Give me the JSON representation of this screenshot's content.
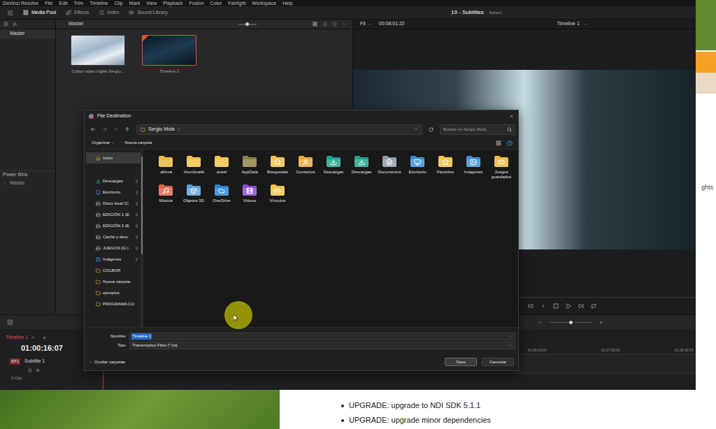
{
  "menubar": {
    "items": [
      "DaVinci Resolve",
      "File",
      "Edit",
      "Trim",
      "Timeline",
      "Clip",
      "Mark",
      "View",
      "Playback",
      "Fusion",
      "Color",
      "Fairlight",
      "Workspace",
      "Help"
    ]
  },
  "toolbar": {
    "panels": [
      {
        "label": "Media Pool",
        "selected": true
      },
      {
        "label": "Effects",
        "selected": false
      },
      {
        "label": "Index",
        "selected": false
      },
      {
        "label": "Sound Library",
        "selected": false
      }
    ],
    "project": "19 - Subtitles",
    "status": "Edited"
  },
  "bins": {
    "master": "Master",
    "power_bins": "Power Bins",
    "power_bins_items": [
      "Master"
    ]
  },
  "media_pool": {
    "bin": "Master",
    "clips": [
      {
        "name": "Colbor video inglés Sergio...",
        "kind": "video",
        "selected": false
      },
      {
        "name": "Timeline 1",
        "kind": "timeline",
        "selected": true
      }
    ]
  },
  "viewer": {
    "zoom": "Fit",
    "timecode": "00:08:01:22",
    "timeline": "Timeline 1"
  },
  "timeline": {
    "tab": "Timeline 1",
    "timecode": "01:00:16:07",
    "track": {
      "id": "ST1",
      "name": "Subtitle 1",
      "clips": "0 Clip"
    },
    "ruler": [
      "01:06:24:00",
      "01:07:28:00",
      "01:08:32:00"
    ]
  },
  "dialog": {
    "title": "File Destination",
    "path": [
      "Sergio Mota"
    ],
    "search_placeholder": "Buscar en Sergio Mota",
    "commands": [
      {
        "label": "Organizar",
        "menu": true
      },
      {
        "label": "Nueva carpeta",
        "menu": false
      }
    ],
    "nav": [
      {
        "label": "Inicio",
        "kind": "home",
        "pinned": false,
        "selected": true
      },
      {
        "label": "Descargas",
        "kind": "download",
        "pinned": true,
        "selected": false
      },
      {
        "label": "Escritorio",
        "kind": "desktop",
        "pinned": true,
        "selected": false
      },
      {
        "label": "Disco local (C",
        "kind": "drive",
        "pinned": true,
        "selected": false
      },
      {
        "label": "EDICIÓN 1 (E",
        "kind": "drive",
        "pinned": true,
        "selected": false
      },
      {
        "label": "EDICIÓN 2 (E",
        "kind": "drive",
        "pinned": true,
        "selected": false
      },
      {
        "label": "Caché y desc",
        "kind": "drive",
        "pinned": true,
        "selected": false
      },
      {
        "label": "JUEGOS (G:)",
        "kind": "drive",
        "pinned": true,
        "selected": false
      },
      {
        "label": "Imágenes",
        "kind": "image",
        "pinned": true,
        "selected": false
      },
      {
        "label": "COLBOR",
        "kind": "folder",
        "pinned": false,
        "selected": false
      },
      {
        "label": "Nueva carpeta",
        "kind": "folder",
        "pinned": false,
        "selected": false
      },
      {
        "label": "ejemplos",
        "kind": "folder",
        "pinned": false,
        "selected": false
      },
      {
        "label": "PROGRAMA CU",
        "kind": "folder",
        "pinned": false,
        "selected": false
      }
    ],
    "folders": [
      {
        "name": ".afirma",
        "kind": "plain",
        "color": "#e8b83a"
      },
      {
        "name": ".thumbnails",
        "kind": "plain",
        "color": "#f0c24a"
      },
      {
        "name": "ansel",
        "kind": "plain",
        "color": "#f0c24a"
      },
      {
        "name": "AppData",
        "kind": "plain",
        "color": "#8f7f45"
      },
      {
        "name": "Búsquedas",
        "kind": "search",
        "color": "#f0c24a"
      },
      {
        "name": "Contactos",
        "kind": "contacts",
        "color": "#e8a840"
      },
      {
        "name": "Descargas",
        "kind": "download",
        "color": "#1fa08a"
      },
      {
        "name": "Descargas",
        "kind": "download",
        "color": "#1fa08a"
      },
      {
        "name": "Documentos",
        "kind": "documents",
        "color": "#8d98a8"
      },
      {
        "name": "Escritorio",
        "kind": "desktop",
        "color": "#3a8fd8"
      },
      {
        "name": "Favoritos",
        "kind": "favorites",
        "color": "#f0c24a"
      },
      {
        "name": "Imágenes",
        "kind": "pictures",
        "color": "#3f8fd8"
      },
      {
        "name": "Juegos guardados",
        "kind": "games",
        "color": "#e8b83a"
      },
      {
        "name": "Música",
        "kind": "music",
        "color": "#e0604a"
      },
      {
        "name": "Objetos 3D",
        "kind": "objects",
        "color": "#5aa0e0"
      },
      {
        "name": "OneDrive",
        "kind": "onedrive",
        "color": "#2a86d8"
      },
      {
        "name": "Vídeos",
        "kind": "videos",
        "color": "#8a4ad8"
      },
      {
        "name": "Vínculos",
        "kind": "links",
        "color": "#f0c24a"
      }
    ],
    "filename": {
      "label": "Nombre:",
      "value": "Timeline 1",
      "selected": true
    },
    "filetype": {
      "label": "Tipo:",
      "value": "Transcription Files (*.txt)"
    },
    "hide_folders": "Ocultar carpetas",
    "buttons": [
      {
        "label": "Save",
        "primary": true
      },
      {
        "label": "Cancelar",
        "primary": false
      }
    ]
  },
  "webpage": {
    "side_text": "ghts",
    "list": [
      "UPGRADE: upgrade to NDI SDK 5.1.1",
      "UPGRADE: upgrade minor dependencies"
    ]
  }
}
